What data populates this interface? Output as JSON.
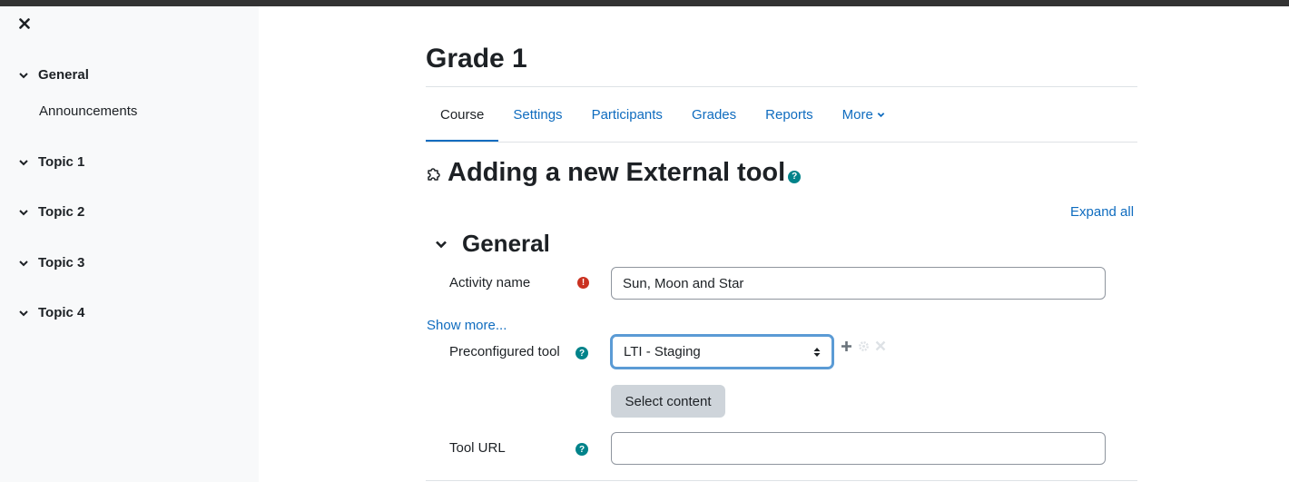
{
  "drawer": {
    "close_icon": "close-icon",
    "sections": [
      {
        "label": "General",
        "items": [
          "Announcements"
        ]
      },
      {
        "label": "Topic 1"
      },
      {
        "label": "Topic 2"
      },
      {
        "label": "Topic 3"
      },
      {
        "label": "Topic 4"
      }
    ]
  },
  "page": {
    "title": "Grade 1",
    "tabs": [
      "Course",
      "Settings",
      "Participants",
      "Grades",
      "Reports",
      "More"
    ],
    "active_tab": "Course"
  },
  "activity": {
    "heading": "Adding a new External tool",
    "help_icon": "?",
    "expand_all": "Expand all",
    "section_general": "General",
    "activity_name_label": "Activity name",
    "required_icon": "!",
    "activity_name_value": "Sun, Moon and Star",
    "show_more": "Show more...",
    "preconfigured_tool_label": "Preconfigured tool",
    "preconfigured_tool_value": "LTI - Staging",
    "select_content_label": "Select content",
    "tool_url_label": "Tool URL",
    "tool_url_value": ""
  },
  "colors": {
    "link": "#0f6cbf",
    "required": "#ca3120",
    "help": "#00838a",
    "drawer_bg": "#f8f9fa"
  }
}
